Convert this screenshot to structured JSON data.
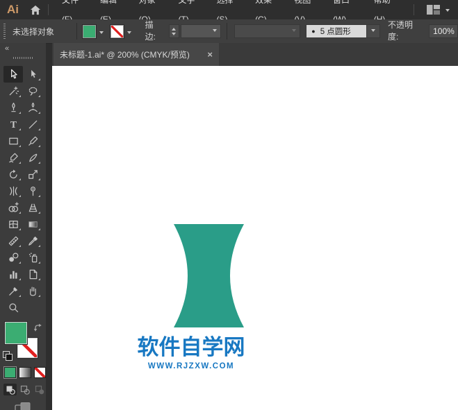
{
  "app": {
    "logo_text": "Ai"
  },
  "menu_bar": {
    "items": [
      "文件(F)",
      "编辑(E)",
      "对象(O)",
      "文字(T)",
      "选择(S)",
      "效果(C)",
      "视图(V)",
      "窗口(W)",
      "帮助(H)"
    ]
  },
  "control_bar": {
    "status": "未选择对象",
    "fill_color": "#3BAD72",
    "stroke_type": "none",
    "stroke_label": "描边:",
    "stroke_weight_value": "",
    "brush_bullet": "●",
    "brush_name": "5 点圆形",
    "opacity_label": "不透明度:",
    "opacity_value": "100%"
  },
  "tab_bar": {
    "tab": {
      "title": "未标题-1.ai* @ 200% (CMYK/预览)",
      "close_glyph": "×",
      "active": true
    }
  },
  "toolbar": {
    "collapse_glyph": "«",
    "active_tool": "selection",
    "tools": [
      "selection",
      "direct-selection",
      "magic-wand",
      "lasso",
      "pen",
      "curvature",
      "type",
      "line-segment",
      "rectangle",
      "paintbrush",
      "shaper",
      "knife",
      "rotate",
      "scale",
      "width",
      "puppet-warp",
      "shape-builder",
      "perspective-grid",
      "mesh",
      "gradient",
      "measure",
      "eyedropper",
      "blend",
      "symbol-sprayer",
      "column-graph",
      "artboard",
      "slice",
      "hand",
      "zoom"
    ],
    "swatches": {
      "fill_color": "#3BAD72",
      "stroke": "none",
      "color_types": [
        "color",
        "gradient",
        "none"
      ],
      "drawing_modes": [
        "draw-normal",
        "draw-behind",
        "draw-inside"
      ]
    }
  },
  "canvas": {
    "shape_color": "#2A9D88",
    "logo_title": "软件自学网",
    "logo_url": "WWW.RJZXW.COM",
    "logo_color": "#1878C2"
  }
}
